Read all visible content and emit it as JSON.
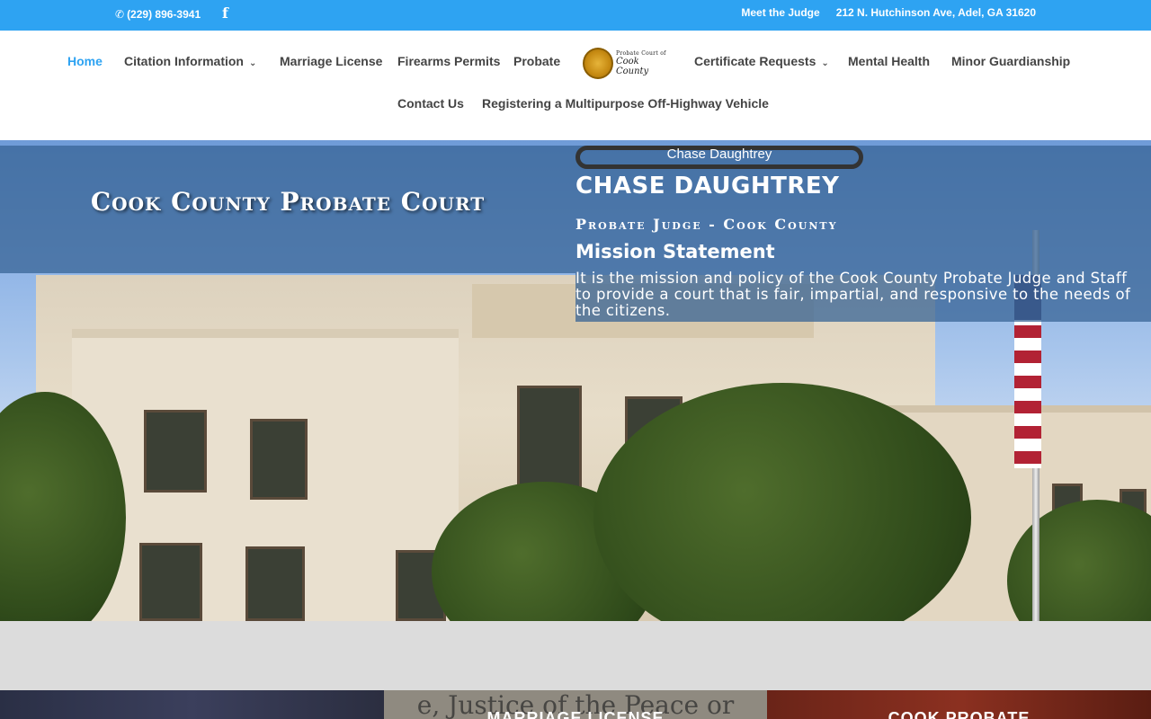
{
  "topbar": {
    "phone": "(229) 896-3941",
    "phone_icon": "phone-icon",
    "facebook_icon": "f",
    "links": [
      "Meet the Judge",
      "212 N. Hutchinson Ave, Adel, GA 31620"
    ]
  },
  "nav": {
    "items": [
      {
        "label": "Home",
        "active": true
      },
      {
        "label": "Citation Information",
        "dropdown": true
      },
      {
        "label": "Marriage License"
      },
      {
        "label": "Firearms Permits"
      },
      {
        "label": "Probate"
      },
      {
        "label": "Certificate Requests",
        "dropdown": true
      },
      {
        "label": "Mental Health"
      },
      {
        "label": "Minor Guardianship"
      },
      {
        "label": "Contact Us"
      },
      {
        "label": "Registering a Multipurpose Off-Highway Vehicle"
      }
    ],
    "logo": {
      "line1": "Probate Court of",
      "line2": "Cook County"
    }
  },
  "hero": {
    "title": "Cook County Probate Court",
    "photo_alt": "Chase Daughtrey",
    "judge_name": "CHASE DAUGHTREY",
    "judge_role": "Probate Judge - Cook County",
    "mission_heading": "Mission Statement",
    "mission_text": "It is the mission and policy of the Cook County Probate Judge and Staff to provide a court that is fair, impartial, and responsive to the needs of the citizens."
  },
  "cards": {
    "c2_bg_text": "e, Justice of the Peace or Minister",
    "c2_caption": "MARRIAGE LICENSE",
    "c3_caption": "COOK PROBATE"
  },
  "colors": {
    "topbar": "#2ea3f2",
    "active_nav": "#2ea3f2",
    "band": "#386496"
  }
}
